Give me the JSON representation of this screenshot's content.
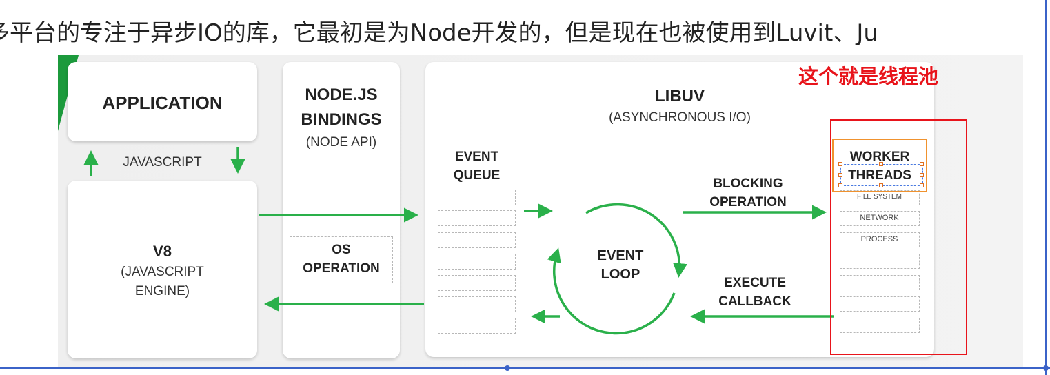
{
  "header_text": "多平台的专注于异步IO的库，它最初是为Node开发的，但是现在也被使用到Luvit、Ju",
  "annotation": "这个就是线程池",
  "colors": {
    "arrow_green": "#2ab04a",
    "annotation_red": "#e8141b",
    "highlight_orange": "#f0922e",
    "selection_blue": "#3b63c8"
  },
  "diagram": {
    "application": "APPLICATION",
    "javascript": "JAVASCRIPT",
    "v8": {
      "title": "V8",
      "sub1": "(JAVASCRIPT",
      "sub2": "ENGINE)"
    },
    "bindings": {
      "line1": "NODE.JS",
      "line2": "BINDINGS",
      "sub": "(NODE API)"
    },
    "os_operation": {
      "line1": "OS",
      "line2": "OPERATION"
    },
    "libuv": {
      "title": "LIBUV",
      "sub": "(ASYNCHRONOUS I/O)"
    },
    "event_queue": {
      "line1": "EVENT",
      "line2": "QUEUE"
    },
    "event_loop": {
      "line1": "EVENT",
      "line2": "LOOP"
    },
    "blocking": {
      "line1": "BLOCKING",
      "line2": "OPERATION"
    },
    "execute": {
      "line1": "EXECUTE",
      "line2": "CALLBACK"
    },
    "worker": {
      "line1": "WORKER",
      "line2": "THREADS"
    },
    "worker_items": [
      "FILE SYSTEM",
      "NETWORK",
      "PROCESS"
    ]
  }
}
